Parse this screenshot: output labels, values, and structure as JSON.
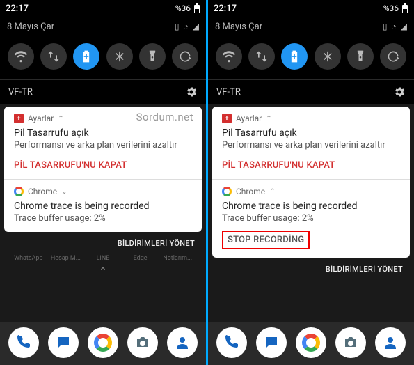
{
  "status": {
    "time": "22:17",
    "battery_pct": "%36"
  },
  "date": "8 Mayıs Çar",
  "carrier": "VF-TR",
  "watermark": "Sordum.net",
  "settings_notif": {
    "app": "Ayarlar",
    "title": "Pil Tasarrufu açık",
    "body": "Performansı ve arka plan verilerini azaltır",
    "action": "PİL TASARRUFU'NU KAPAT"
  },
  "chrome_notif": {
    "app": "Chrome",
    "title": "Chrome trace is being recorded",
    "body": "Trace buffer usage: 2%",
    "stop_action": "STOP RECORDİNG"
  },
  "manage": "BİLDİRİMLERİ YÖNET",
  "apps_shade": [
    "WhatsApp",
    "Hesap M...",
    "LINE",
    "Edge",
    "Notlarım..."
  ]
}
